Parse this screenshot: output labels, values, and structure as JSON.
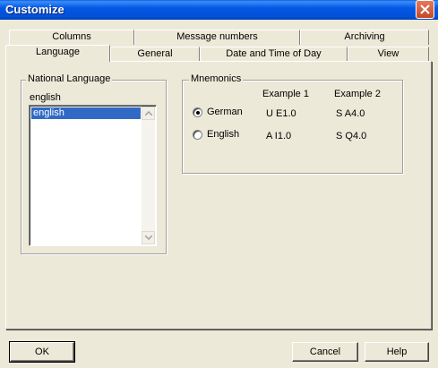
{
  "window": {
    "title": "Customize"
  },
  "tabs": {
    "back_row": [
      "Columns",
      "Message numbers",
      "Archiving"
    ],
    "front_row": [
      "Language",
      "General",
      "Date and Time of Day",
      "View"
    ],
    "active": "Language"
  },
  "national_language": {
    "legend": "National Language",
    "current_value": "english",
    "list_items": [
      "english"
    ],
    "selected_item": "english"
  },
  "mnemonics": {
    "legend": "Mnemonics",
    "col1_header": "Example 1",
    "col2_header": "Example 2",
    "options": [
      {
        "label": "German",
        "selected": true,
        "example1": "U E1.0",
        "example2": "S A4.0"
      },
      {
        "label": "English",
        "selected": false,
        "example1": "A I1.0",
        "example2": "S Q4.0"
      }
    ]
  },
  "buttons": {
    "ok": "OK",
    "cancel": "Cancel",
    "help": "Help"
  },
  "icons": {
    "close": "close-icon",
    "scroll_up": "scroll-up-arrow-icon",
    "scroll_down": "scroll-down-arrow-icon"
  },
  "colors": {
    "titlebar": "#0458e6",
    "selection": "#316ac5",
    "face": "#ece9d8"
  }
}
